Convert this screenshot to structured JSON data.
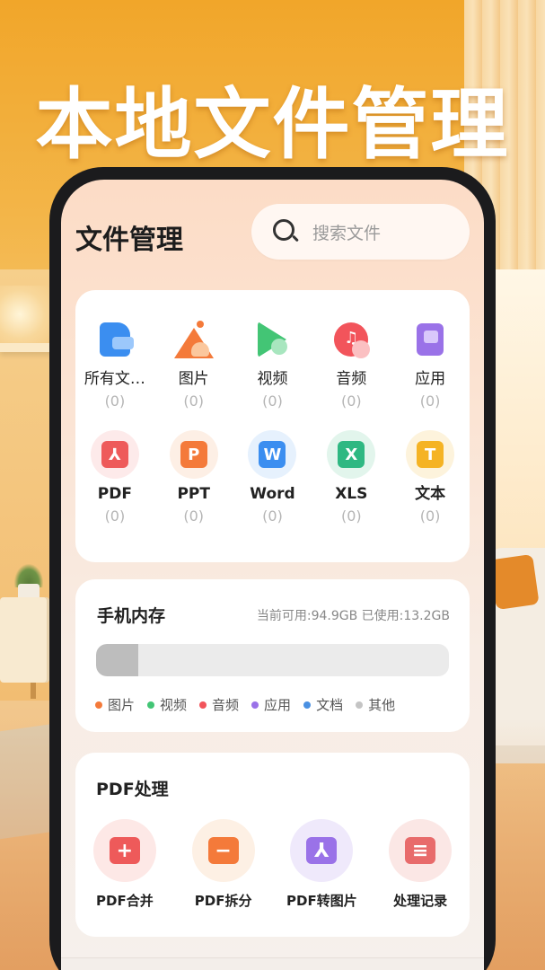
{
  "hero": {
    "title": "本地文件管理"
  },
  "header": {
    "title": "文件管理",
    "search_placeholder": "搜索文件"
  },
  "categories": [
    {
      "label": "所有文…",
      "count": "(0)",
      "icon": "all-files-icon",
      "color": "#3b8ef0"
    },
    {
      "label": "图片",
      "count": "(0)",
      "icon": "image-icon",
      "color": "#f47a3a"
    },
    {
      "label": "视频",
      "count": "(0)",
      "icon": "video-icon",
      "color": "#43c575"
    },
    {
      "label": "音频",
      "count": "(0)",
      "icon": "audio-icon",
      "color": "#f2545b"
    },
    {
      "label": "应用",
      "count": "(0)",
      "icon": "app-icon",
      "color": "#9a72e8"
    }
  ],
  "file_types": [
    {
      "label": "PDF",
      "count": "(0)",
      "glyph": "⅄",
      "icon": "pdf-icon",
      "color": "#ee5a5a",
      "bg": "#fdeaea"
    },
    {
      "label": "PPT",
      "count": "(0)",
      "glyph": "P",
      "icon": "ppt-icon",
      "color": "#f47a3a",
      "bg": "#fdefe5"
    },
    {
      "label": "Word",
      "count": "(0)",
      "glyph": "W",
      "icon": "word-icon",
      "color": "#3b8ef0",
      "bg": "#e6f1fd"
    },
    {
      "label": "XLS",
      "count": "(0)",
      "glyph": "X",
      "icon": "xls-icon",
      "color": "#2fb882",
      "bg": "#e2f5ec"
    },
    {
      "label": "文本",
      "count": "(0)",
      "glyph": "T",
      "icon": "text-icon",
      "color": "#f5b324",
      "bg": "#fdf3dc"
    }
  ],
  "storage": {
    "title": "手机内存",
    "info": "当前可用:94.9GB  已使用:13.2GB",
    "used_fraction": 0.12,
    "legend": [
      {
        "label": "图片",
        "color": "#f47a3a"
      },
      {
        "label": "视频",
        "color": "#43c575"
      },
      {
        "label": "音频",
        "color": "#f2545b"
      },
      {
        "label": "应用",
        "color": "#9a72e8"
      },
      {
        "label": "文档",
        "color": "#4a90e2"
      },
      {
        "label": "其他",
        "color": "#c4c4c4"
      }
    ]
  },
  "pdf": {
    "title": "PDF处理",
    "tools": [
      {
        "label": "PDF合并",
        "glyph": "+",
        "icon": "pdf-merge-icon",
        "color": "#ee5a5a",
        "bg": "#fde8e6"
      },
      {
        "label": "PDF拆分",
        "glyph": "−",
        "icon": "pdf-split-icon",
        "color": "#f47a3a",
        "bg": "#fdf0e4"
      },
      {
        "label": "PDF转图片",
        "glyph": "⅄",
        "icon": "pdf-to-image-icon",
        "color": "#9a72e8",
        "bg": "#efe9fb"
      },
      {
        "label": "处理记录",
        "glyph": "≡",
        "icon": "history-icon",
        "color": "#e86b6b",
        "bg": "#fbe7e5"
      }
    ]
  }
}
